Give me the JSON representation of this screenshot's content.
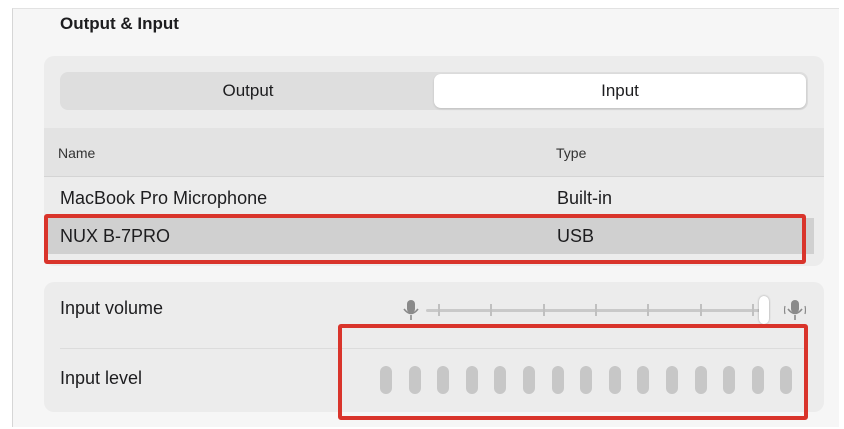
{
  "section": {
    "title": "Output & Input"
  },
  "tabs": [
    {
      "label": "Output",
      "selected": false
    },
    {
      "label": "Input",
      "selected": true
    }
  ],
  "table": {
    "columns": [
      "Name",
      "Type"
    ],
    "rows": [
      {
        "name": "MacBook Pro Microphone",
        "type": "Built-in",
        "selected": false
      },
      {
        "name": "NUX B-7PRO",
        "type": "USB",
        "selected": true
      }
    ]
  },
  "controls": {
    "input_volume": {
      "label": "Input volume",
      "value_fraction": 1.0,
      "min_icon": "microphone-low-icon",
      "max_icon": "microphone-high-icon"
    },
    "input_level": {
      "label": "Input level",
      "segments_total": 15,
      "segments_lit": 0
    }
  },
  "colors": {
    "highlight": "#d9342b",
    "selected_row": "#d0d0d0",
    "segment": "#c7c7c7"
  }
}
